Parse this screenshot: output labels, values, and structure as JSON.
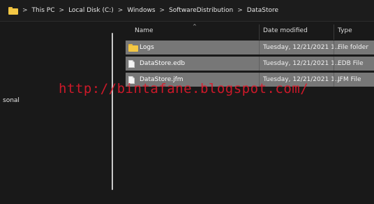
{
  "address_bar": {
    "crumbs": [
      "This PC",
      "Local Disk (C:)",
      "Windows",
      "SoftwareDistribution",
      "DataStore"
    ],
    "separator": ">"
  },
  "nav": {
    "partial_item": "sonal"
  },
  "columns": {
    "name": "Name",
    "date": "Date modified",
    "type": "Type"
  },
  "files": [
    {
      "name": "Logs",
      "date": "Tuesday, 12/21/2021 1...",
      "type": "File folder",
      "icon": "folder-icon"
    },
    {
      "name": "DataStore.edb",
      "date": "Tuesday, 12/21/2021 1...",
      "type": "EDB File",
      "icon": "file-icon"
    },
    {
      "name": "DataStore.jfm",
      "date": "Tuesday, 12/21/2021 1...",
      "type": "JFM File",
      "icon": "file-icon"
    }
  ],
  "watermark": "http://bintafane.blogspot.com/",
  "colors": {
    "folder": "#f3c744",
    "selection": "#777777",
    "watermark": "#e0192b",
    "background": "#191919"
  }
}
